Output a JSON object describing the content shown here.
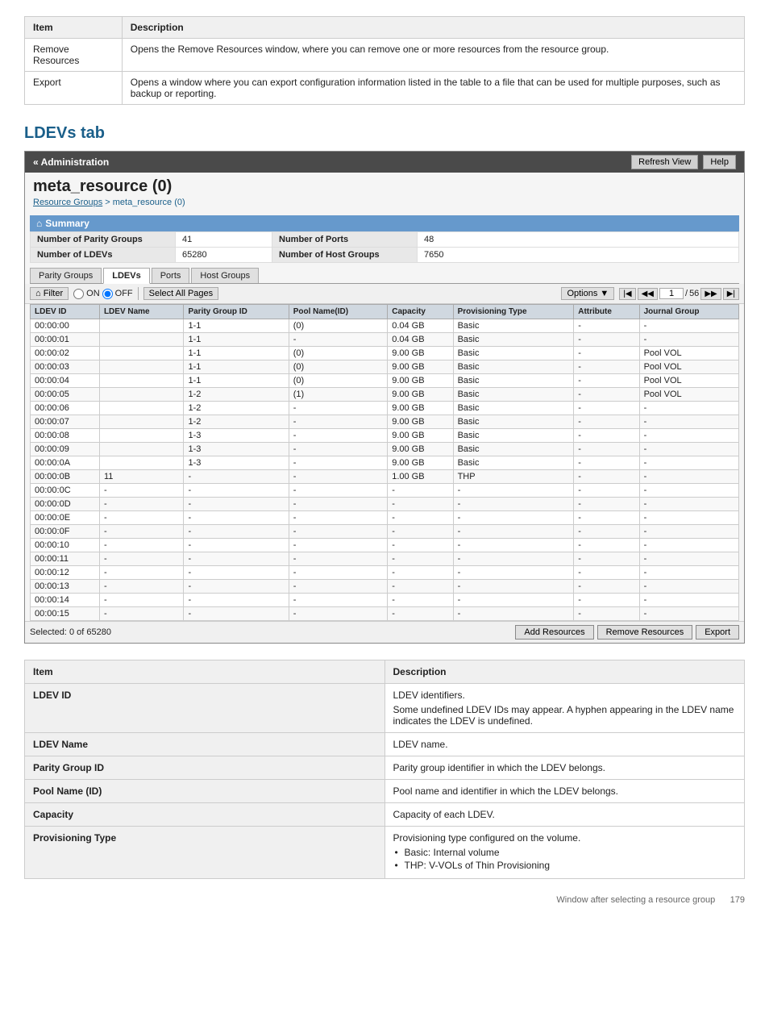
{
  "top_table": {
    "col1": "Item",
    "col2": "Description",
    "rows": [
      {
        "item": "Remove Resources",
        "description": "Opens the Remove Resources window, where you can remove one or more resources from the resource group."
      },
      {
        "item": "Export",
        "description": "Opens a window where you can export configuration information listed in the table to a file that can be used for multiple purposes, such as backup or reporting."
      }
    ]
  },
  "section": {
    "heading": "LDEVs tab"
  },
  "admin": {
    "header_label": "« Administration",
    "refresh_btn": "Refresh View",
    "help_btn": "Help",
    "resource_title": "meta_resource (0)",
    "breadcrumb_link": "Resource Groups",
    "breadcrumb_sep": " > ",
    "breadcrumb_current": "meta_resource (0)"
  },
  "summary": {
    "title": "⌂ Summary",
    "labels": {
      "parity_groups_label": "Number of Parity Groups",
      "parity_groups_value": "41",
      "ldevs_label": "Number of LDEVs",
      "ldevs_value": "65280",
      "ports_label": "Number of Ports",
      "ports_value": "48",
      "host_groups_label": "Number of Host Groups",
      "host_groups_value": "7650"
    }
  },
  "tabs": [
    {
      "label": "Parity Groups",
      "active": false
    },
    {
      "label": "LDEVs",
      "active": true
    },
    {
      "label": "Ports",
      "active": false
    },
    {
      "label": "Host Groups",
      "active": false
    }
  ],
  "filter_bar": {
    "filter_btn": "⌂ Filter",
    "on_label": "ON",
    "off_label": "OFF",
    "select_all_btn": "Select All Pages",
    "options_btn": "Options ▼",
    "nav_first": "◀◀",
    "nav_prev": "◀◀",
    "page_current": "1",
    "page_sep": "/",
    "page_total": "56",
    "nav_next": "▶▶",
    "nav_last": "▶|"
  },
  "table": {
    "columns": [
      "LDEV ID",
      "LDEV Name",
      "Parity Group ID",
      "Pool Name(ID)",
      "Capacity",
      "Provisioning Type",
      "Attribute",
      "Journal Group"
    ],
    "rows": [
      [
        "00:00:00",
        "",
        "1-1",
        "(0)",
        "0.04 GB",
        "Basic",
        "-",
        "-"
      ],
      [
        "00:00:01",
        "",
        "1-1",
        "-",
        "0.04 GB",
        "Basic",
        "-",
        "-"
      ],
      [
        "00:00:02",
        "",
        "1-1",
        "(0)",
        "9.00 GB",
        "Basic",
        "-",
        "Pool VOL"
      ],
      [
        "00:00:03",
        "",
        "1-1",
        "(0)",
        "9.00 GB",
        "Basic",
        "-",
        "Pool VOL"
      ],
      [
        "00:00:04",
        "",
        "1-1",
        "(0)",
        "9.00 GB",
        "Basic",
        "-",
        "Pool VOL"
      ],
      [
        "00:00:05",
        "",
        "1-2",
        "(1)",
        "9.00 GB",
        "Basic",
        "-",
        "Pool VOL"
      ],
      [
        "00:00:06",
        "",
        "1-2",
        "-",
        "9.00 GB",
        "Basic",
        "-",
        "-"
      ],
      [
        "00:00:07",
        "",
        "1-2",
        "-",
        "9.00 GB",
        "Basic",
        "-",
        "-"
      ],
      [
        "00:00:08",
        "",
        "1-3",
        "-",
        "9.00 GB",
        "Basic",
        "-",
        "-"
      ],
      [
        "00:00:09",
        "",
        "1-3",
        "-",
        "9.00 GB",
        "Basic",
        "-",
        "-"
      ],
      [
        "00:00:0A",
        "",
        "1-3",
        "-",
        "9.00 GB",
        "Basic",
        "-",
        "-"
      ],
      [
        "00:00:0B",
        "11",
        "-",
        "-",
        "1.00 GB",
        "THP",
        "-",
        "-"
      ],
      [
        "00:00:0C",
        "-",
        "-",
        "-",
        "-",
        "-",
        "-",
        "-"
      ],
      [
        "00:00:0D",
        "-",
        "-",
        "-",
        "-",
        "-",
        "-",
        "-"
      ],
      [
        "00:00:0E",
        "-",
        "-",
        "-",
        "-",
        "-",
        "-",
        "-"
      ],
      [
        "00:00:0F",
        "-",
        "-",
        "-",
        "-",
        "-",
        "-",
        "-"
      ],
      [
        "00:00:10",
        "-",
        "-",
        "-",
        "-",
        "-",
        "-",
        "-"
      ],
      [
        "00:00:11",
        "-",
        "-",
        "-",
        "-",
        "-",
        "-",
        "-"
      ],
      [
        "00:00:12",
        "-",
        "-",
        "-",
        "-",
        "-",
        "-",
        "-"
      ],
      [
        "00:00:13",
        "-",
        "-",
        "-",
        "-",
        "-",
        "-",
        "-"
      ],
      [
        "00:00:14",
        "-",
        "-",
        "-",
        "-",
        "-",
        "-",
        "-"
      ],
      [
        "00:00:15",
        "-",
        "-",
        "-",
        "-",
        "-",
        "-",
        "-"
      ]
    ]
  },
  "bottom_bar": {
    "selected_label": "Selected:",
    "selected_value": "0",
    "of_label": "of",
    "total_value": "65280",
    "add_btn": "Add Resources",
    "remove_btn": "Remove Resources",
    "export_btn": "Export"
  },
  "desc_table": {
    "col1": "Item",
    "col2": "Description",
    "rows": [
      {
        "item": "LDEV ID",
        "description": "LDEV identifiers.",
        "description2": "Some undefined LDEV IDs may appear. A hyphen appearing in the LDEV name indicates the LDEV is undefined."
      },
      {
        "item": "LDEV Name",
        "description": "LDEV name.",
        "description2": ""
      },
      {
        "item": "Parity Group ID",
        "description": "Parity group identifier in which the LDEV belongs.",
        "description2": ""
      },
      {
        "item": "Pool Name (ID)",
        "description": "Pool name and identifier in which the LDEV belongs.",
        "description2": ""
      },
      {
        "item": "Capacity",
        "description": "Capacity of each LDEV.",
        "description2": ""
      },
      {
        "item": "Provisioning Type",
        "description": "Provisioning type configured on the volume.",
        "description2": "",
        "bullets": [
          "Basic: Internal volume",
          "THP: V-VOLs of Thin Provisioning"
        ]
      }
    ]
  },
  "footer": {
    "text": "Window after selecting a resource group",
    "page": "179"
  }
}
